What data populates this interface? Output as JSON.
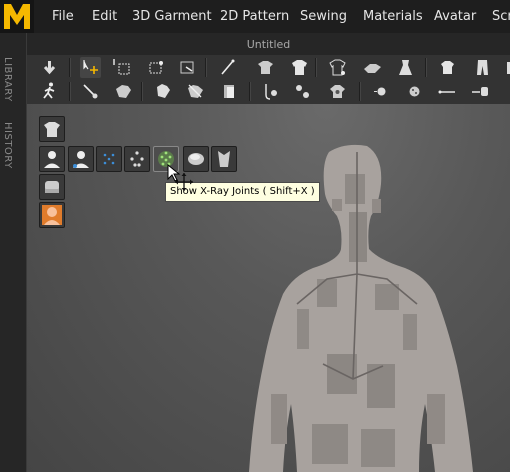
{
  "app": {
    "logo_letter": "M",
    "accent": "#f5b800",
    "doc_title": "Untitled"
  },
  "menu": {
    "items": [
      "File",
      "Edit",
      "3D Garment",
      "2D Pattern",
      "Sewing",
      "Materials",
      "Avatar",
      "Scr"
    ]
  },
  "sidebar": {
    "library": "LIBRARY",
    "history": "HISTORY"
  },
  "viewport": {
    "tooltip": "Show X-Ray Joints ( Shift+X )",
    "background": "#595959",
    "avatar_color": "#a8a29e"
  }
}
